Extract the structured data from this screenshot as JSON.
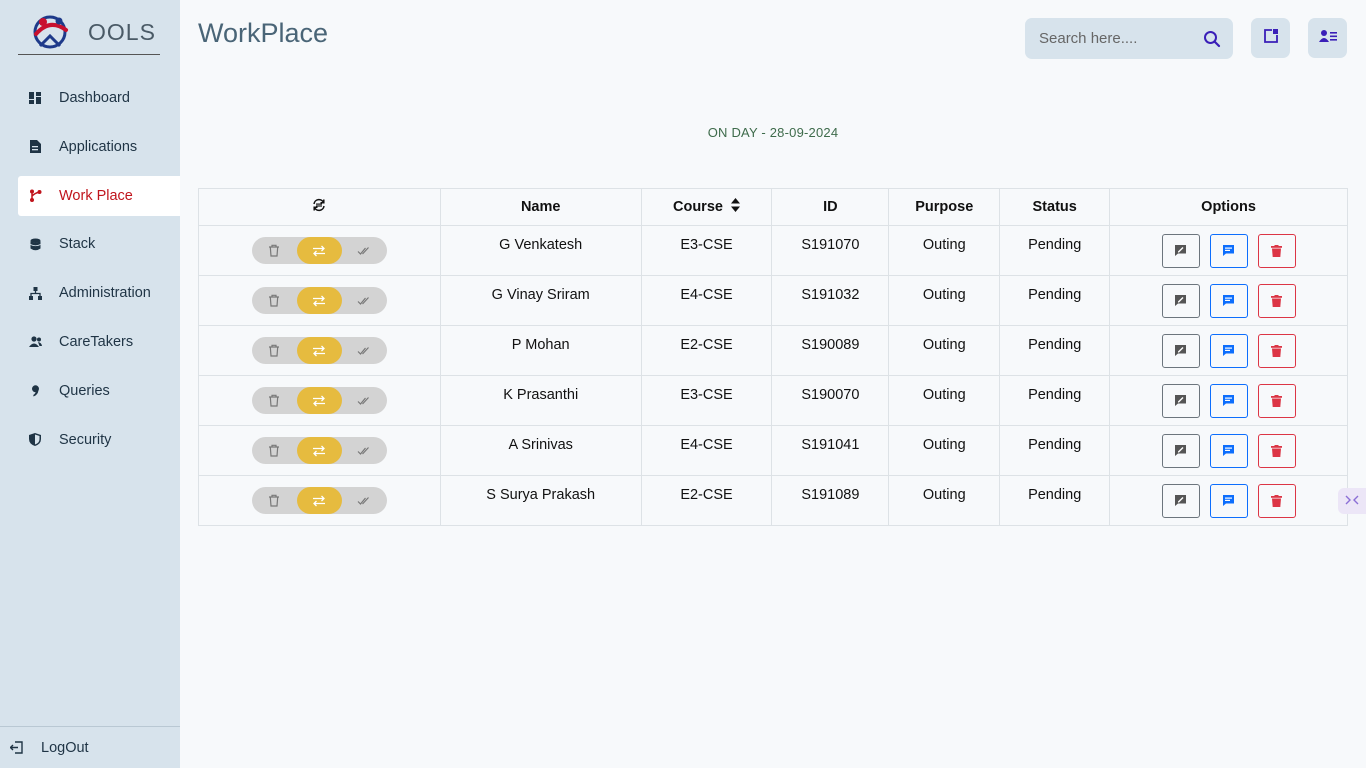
{
  "logo": {
    "text": "OOLS"
  },
  "sidebar": {
    "items": [
      {
        "label": "Dashboard",
        "icon": "dashboard-icon"
      },
      {
        "label": "Applications",
        "icon": "document-icon"
      },
      {
        "label": "Work Place",
        "icon": "branch-icon",
        "active": true
      },
      {
        "label": "Stack",
        "icon": "database-icon"
      },
      {
        "label": "Administration",
        "icon": "hierarchy-icon"
      },
      {
        "label": "CareTakers",
        "icon": "users-icon"
      },
      {
        "label": "Queries",
        "icon": "quote-icon"
      },
      {
        "label": "Security",
        "icon": "shield-icon"
      }
    ],
    "logout_label": "LogOut"
  },
  "header": {
    "title": "WorkPlace",
    "search_placeholder": "Search here...."
  },
  "day_label": "ON DAY - 28-09-2024",
  "table": {
    "columns": [
      "",
      "Name",
      "Course",
      "ID",
      "Purpose",
      "Status",
      "Options"
    ],
    "rows": [
      {
        "name": "G Venkatesh",
        "course": "E3-CSE",
        "id": "S191070",
        "purpose": "Outing",
        "status": "Pending"
      },
      {
        "name": "G Vinay Sriram",
        "course": "E4-CSE",
        "id": "S191032",
        "purpose": "Outing",
        "status": "Pending"
      },
      {
        "name": "P Mohan",
        "course": "E2-CSE",
        "id": "S190089",
        "purpose": "Outing",
        "status": "Pending"
      },
      {
        "name": "K Prasanthi",
        "course": "E3-CSE",
        "id": "S190070",
        "purpose": "Outing",
        "status": "Pending"
      },
      {
        "name": "A Srinivas",
        "course": "E4-CSE",
        "id": "S191041",
        "purpose": "Outing",
        "status": "Pending"
      },
      {
        "name": "S Surya Prakash",
        "course": "E2-CSE",
        "id": "S191089",
        "purpose": "Outing",
        "status": "Pending"
      }
    ]
  },
  "colors": {
    "sidebar_bg": "#d7e3ec",
    "active_text": "#c0141c",
    "toggle_active": "#e6bb3f",
    "btn_blue": "#0d6efd",
    "btn_red": "#dc3545",
    "btn_gray": "#6c757d"
  }
}
